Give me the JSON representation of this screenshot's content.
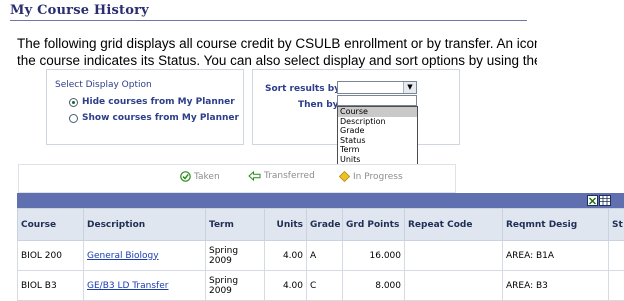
{
  "page": {
    "title": "My Course History",
    "intro_line1": "The following grid displays all course credit by CSULB enrollment or by transfer. An icon to th",
    "intro_line2": "the course indicates its Status. You can also select display and sort options by using the box"
  },
  "display_option": {
    "heading": "Select Display Option",
    "options": [
      {
        "label": "Hide courses from My Planner",
        "checked": true
      },
      {
        "label": "Show courses from My Planner",
        "checked": false
      }
    ]
  },
  "sort": {
    "sort_label": "Sort results by",
    "then_label": "Then by",
    "options": [
      "Course",
      "Description",
      "Grade",
      "Status",
      "Term",
      "Units"
    ],
    "highlighted_option": "Course"
  },
  "legend": {
    "taken": "Taken",
    "transferred": "Transferred",
    "in_progress": "In Progress"
  },
  "colors": {
    "header_bar": "#5f6fb0",
    "title": "#2a2e6f",
    "label": "#2d3e8a",
    "link": "#1a3cb0",
    "taken_icon": "#2e8b1e",
    "in_progress_icon": "#f0c020"
  },
  "grid": {
    "columns": [
      "Course",
      "Description",
      "Term",
      "Units",
      "Grade",
      "Grd Points",
      "Repeat Code",
      "Reqmnt Desig",
      "St"
    ],
    "rows": [
      {
        "course": "BIOL 200",
        "description": "General Biology",
        "term_line1": "Spring",
        "term_line2": "2009",
        "units": "4.00",
        "grade": "A",
        "grd_points": "16.000",
        "repeat_code": "",
        "reqmnt_desig": "AREA: B1A"
      },
      {
        "course": "BIOL B3",
        "description": "GE/B3 LD Transfer",
        "term_line1": "Spring",
        "term_line2": "2009",
        "units": "4.00",
        "grade": "C",
        "grd_points": "8.000",
        "repeat_code": "",
        "reqmnt_desig": "AREA: B3"
      }
    ]
  }
}
